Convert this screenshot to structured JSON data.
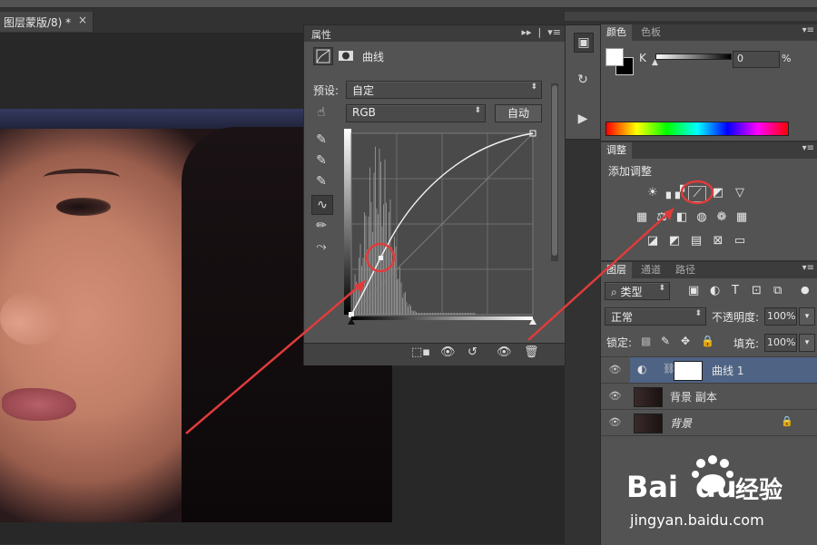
{
  "document": {
    "tab_title": "图层蒙版/8) *",
    "close_glyph": "×"
  },
  "properties": {
    "title": "属性",
    "header_label": "曲线",
    "preset_label": "预设:",
    "preset_value": "自定",
    "channel_value": "RGB",
    "auto_button": "自动"
  },
  "color_panel": {
    "tabs": [
      "颜色",
      "色板"
    ],
    "channel_label": "K",
    "channel_value": "0",
    "unit": "%"
  },
  "adjustments": {
    "tab": "调整",
    "add_label": "添加调整"
  },
  "layers": {
    "tabs": [
      "图层",
      "通道",
      "路径"
    ],
    "filter_value": "类型",
    "blend_mode": "正常",
    "opacity_label": "不透明度:",
    "opacity_value": "100%",
    "lock_label": "锁定:",
    "fill_label": "填充:",
    "fill_value": "100%",
    "items": [
      {
        "name": "曲线 1",
        "selected": true
      },
      {
        "name": "背景 副本",
        "selected": false
      },
      {
        "name": "背景",
        "selected": false,
        "italic": true,
        "locked": true
      }
    ]
  },
  "watermark": {
    "brand": "Bai",
    "brand2": "du",
    "cn": "经验",
    "url": "jingyan.baidu.com"
  },
  "colors": {
    "annotation": "#e03b3b",
    "accent_selected": "#4f6484",
    "spectrum": [
      "#ff0000",
      "#ffff00",
      "#00ff00",
      "#00ffff",
      "#0000ff",
      "#ff00ff",
      "#ff0000"
    ]
  }
}
